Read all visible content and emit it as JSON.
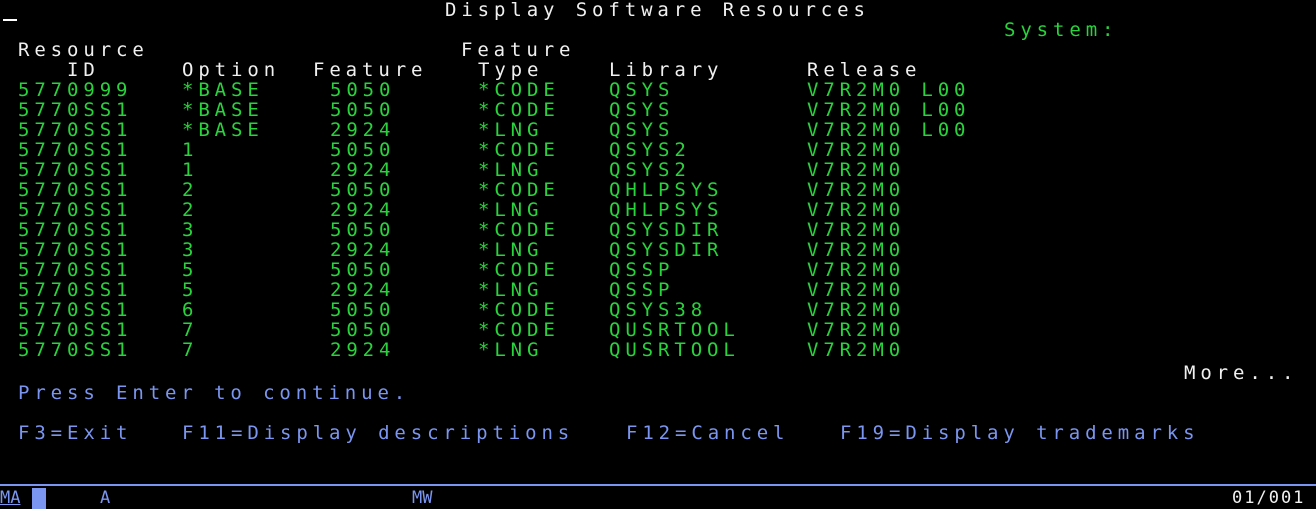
{
  "screen": {
    "title": "Display Software Resources",
    "system_label": "System:",
    "headers": {
      "row1": {
        "resource": "Resource",
        "feature_type": "Feature"
      },
      "row2": {
        "id": "ID",
        "option": "Option",
        "feature": "Feature",
        "type": "Type",
        "library": "Library",
        "release": "Release"
      }
    },
    "rows": [
      {
        "id": "5770999",
        "option": "*BASE",
        "feature": "5050",
        "type": "*CODE",
        "library": "QSYS",
        "release": "V7R2M0 L00"
      },
      {
        "id": "5770SS1",
        "option": "*BASE",
        "feature": "5050",
        "type": "*CODE",
        "library": "QSYS",
        "release": "V7R2M0 L00"
      },
      {
        "id": "5770SS1",
        "option": "*BASE",
        "feature": "2924",
        "type": "*LNG",
        "library": "QSYS",
        "release": "V7R2M0 L00"
      },
      {
        "id": "5770SS1",
        "option": "1",
        "feature": "5050",
        "type": "*CODE",
        "library": "QSYS2",
        "release": "V7R2M0"
      },
      {
        "id": "5770SS1",
        "option": "1",
        "feature": "2924",
        "type": "*LNG",
        "library": "QSYS2",
        "release": "V7R2M0"
      },
      {
        "id": "5770SS1",
        "option": "2",
        "feature": "5050",
        "type": "*CODE",
        "library": "QHLPSYS",
        "release": "V7R2M0"
      },
      {
        "id": "5770SS1",
        "option": "2",
        "feature": "2924",
        "type": "*LNG",
        "library": "QHLPSYS",
        "release": "V7R2M0"
      },
      {
        "id": "5770SS1",
        "option": "3",
        "feature": "5050",
        "type": "*CODE",
        "library": "QSYSDIR",
        "release": "V7R2M0"
      },
      {
        "id": "5770SS1",
        "option": "3",
        "feature": "2924",
        "type": "*LNG",
        "library": "QSYSDIR",
        "release": "V7R2M0"
      },
      {
        "id": "5770SS1",
        "option": "5",
        "feature": "5050",
        "type": "*CODE",
        "library": "QSSP",
        "release": "V7R2M0"
      },
      {
        "id": "5770SS1",
        "option": "5",
        "feature": "2924",
        "type": "*LNG",
        "library": "QSSP",
        "release": "V7R2M0"
      },
      {
        "id": "5770SS1",
        "option": "6",
        "feature": "5050",
        "type": "*CODE",
        "library": "QSYS38",
        "release": "V7R2M0"
      },
      {
        "id": "5770SS1",
        "option": "7",
        "feature": "5050",
        "type": "*CODE",
        "library": "QUSRTOOL",
        "release": "V7R2M0"
      },
      {
        "id": "5770SS1",
        "option": "7",
        "feature": "2924",
        "type": "*LNG",
        "library": "QUSRTOOL",
        "release": "V7R2M0"
      }
    ],
    "more": "More...",
    "instruction": "Press Enter to continue.",
    "function_keys": [
      {
        "label": "F3=Exit"
      },
      {
        "label": "F11=Display descriptions"
      },
      {
        "label": "F12=Cancel"
      },
      {
        "label": "F19=Display trademarks"
      }
    ]
  },
  "status_bar": {
    "mode": "MA",
    "field_a": "A",
    "mw": "MW",
    "position": "01/001"
  },
  "colors": {
    "background": "#000000",
    "title": "#f0f0f0",
    "field": "#29d33c",
    "info": "#7b96f0"
  }
}
